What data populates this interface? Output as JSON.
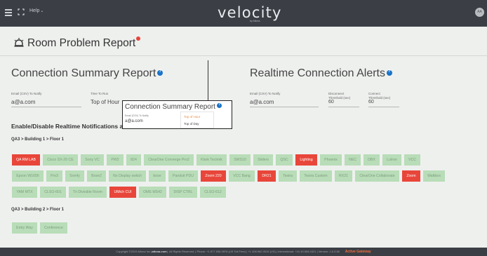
{
  "header": {
    "help_label": "Help",
    "logo_text": "velocity",
    "logo_subtext": "by Atlona",
    "avatar_initials": "AA"
  },
  "page": {
    "title": "Room Problem Report"
  },
  "summary": {
    "title": "Connection Summary Report",
    "email_label": "Email (CSV) To Notify",
    "email_value": "a@a.com",
    "time_label": "Time To Run",
    "time_value": "Top of Hour"
  },
  "alerts": {
    "title": "Realtime Connection Alerts",
    "email_label": "Email (CSV) To Notify",
    "email_value": "a@a.com",
    "disconnect_label": "Disconnect\nThreshold (sec)",
    "disconnect_label_1": "Disconnect",
    "disconnect_label_2": "Threshold (sec)",
    "disconnect_value": "60",
    "connect_label_1": "Connect",
    "connect_label_2": "Threshold (sec)",
    "connect_value": "60"
  },
  "popup": {
    "title": "Connection Summary Report",
    "email_label": "Email (CSV) To Notify",
    "email_value": "a@a.com",
    "options": [
      "Top of Hour",
      "Top of Day"
    ]
  },
  "notifications": {
    "title": "Enable/Disable Realtime Notifications and",
    "groups": [
      {
        "label": "QA3 > Building 1 > Floor 1",
        "rows": [
          [
            {
              "label": "QA RM LAB",
              "active": true
            },
            {
              "label": "Cisco SX-20 CE",
              "active": false
            },
            {
              "label": "Sony VC",
              "active": false
            },
            {
              "label": "PW2",
              "active": false
            },
            {
              "label": "824",
              "active": false
            },
            {
              "label": "ClearOne Converge Pro2",
              "active": false
            },
            {
              "label": "Klark Technik",
              "active": false
            },
            {
              "label": "SWS10",
              "active": false
            },
            {
              "label": "Sliders",
              "active": false
            },
            {
              "label": "QSC",
              "active": false
            },
            {
              "label": "Lighting",
              "active": true
            },
            {
              "label": "Phoenix",
              "active": false
            },
            {
              "label": "NEC",
              "active": false
            },
            {
              "label": "DBX",
              "active": false
            },
            {
              "label": "Lutron",
              "active": false
            },
            {
              "label": "VCC",
              "active": false
            }
          ],
          [
            {
              "label": "Epson W1656",
              "active": false
            },
            {
              "label": "Pro3",
              "active": false
            },
            {
              "label": "Somfy",
              "active": false
            },
            {
              "label": "Bose2",
              "active": false
            },
            {
              "label": "No Display switch",
              "active": false
            },
            {
              "label": "bose",
              "active": false
            },
            {
              "label": "Panduit PDU",
              "active": false
            },
            {
              "label": "Zoom 220",
              "active": true
            },
            {
              "label": "VCC Bang",
              "active": false
            },
            {
              "label": "DR21",
              "active": true
            },
            {
              "label": "Tesira",
              "active": false
            },
            {
              "label": "Tesira Custom",
              "active": false
            },
            {
              "label": "RX21",
              "active": false
            },
            {
              "label": "ClearOne Collaborate",
              "active": false
            },
            {
              "label": "Zoom",
              "active": true
            },
            {
              "label": "Wattbox",
              "active": false
            }
          ],
          [
            {
              "label": "YAM MTX",
              "active": false
            },
            {
              "label": "CLSO-601",
              "active": false
            },
            {
              "label": "Tri Divisible Room",
              "active": false
            },
            {
              "label": "UMich CUI",
              "active": true
            },
            {
              "label": "OME MS42",
              "active": false
            },
            {
              "label": "DISP CTRL",
              "active": false
            },
            {
              "label": "CLSO-612",
              "active": false
            }
          ]
        ]
      },
      {
        "label": "QA3 > Building 2 > Floor 1",
        "rows": [
          [
            {
              "label": "Entry Way",
              "active": false
            },
            {
              "label": "Conference",
              "active": false
            }
          ]
        ]
      }
    ]
  },
  "footer": {
    "copyright": "Copyright ©2019 Atlona Inc (",
    "brand": "atlona.com",
    "rest": "). All Rights Reserved. | Phone: +1 877.536.3976 (US Toll Free) | +1 408.962.0515 (US) | International: +41.43.508.4321 | Version: 1.6.3.38",
    "active_gateway": "Active Gateway"
  },
  "colors": {
    "chip_inactive": "#b8ddb8",
    "chip_active": "#e8463a",
    "topbar": "#3b3f45",
    "info": "#1a73c8",
    "accent_orange": "#e98b46"
  }
}
